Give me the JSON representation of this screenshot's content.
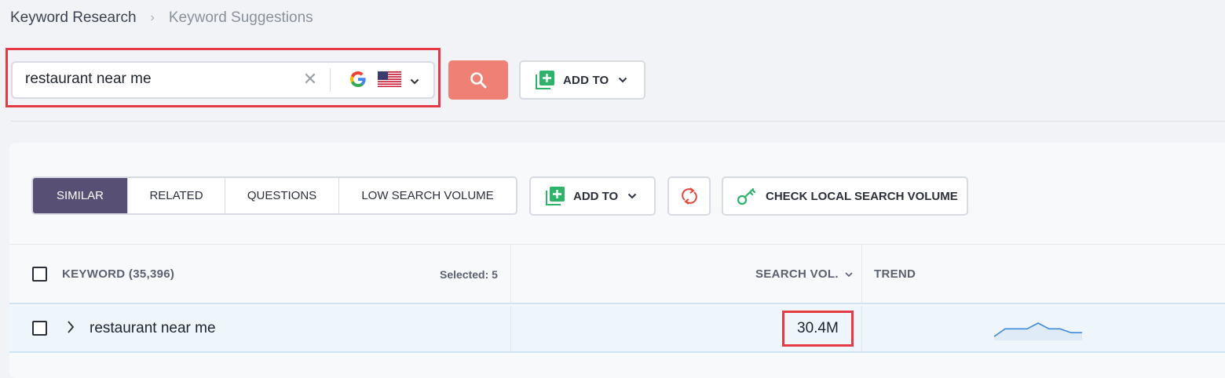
{
  "breadcrumb": {
    "root": "Keyword Research",
    "separator": "›",
    "current": "Keyword Suggestions"
  },
  "search": {
    "query": "restaurant near me",
    "clear_icon": "close-icon",
    "engine_icon": "google-icon",
    "country_icon": "us-flag-icon"
  },
  "top_toolbar": {
    "add_to_label": "ADD TO"
  },
  "tabs": [
    {
      "label": "SIMILAR",
      "active": true
    },
    {
      "label": "RELATED",
      "active": false
    },
    {
      "label": "QUESTIONS",
      "active": false
    },
    {
      "label": "LOW SEARCH VOLUME",
      "active": false
    }
  ],
  "table_toolbar": {
    "add_to_label": "ADD TO",
    "check_local_label": "CHECK LOCAL SEARCH VOLUME"
  },
  "table": {
    "keyword_header": "KEYWORD (35,396)",
    "selected_label": "Selected: 5",
    "search_vol_header": "SEARCH VOL.",
    "trend_header": "TREND",
    "rows": [
      {
        "keyword": "restaurant near me",
        "search_volume": "30.4M",
        "trend": [
          2,
          6,
          6,
          6,
          9,
          6,
          6,
          4,
          4
        ]
      }
    ]
  },
  "colors": {
    "accent_red": "#e63946",
    "search_button": "#ef8076",
    "tab_active": "#574f74",
    "green": "#2fb36b",
    "trend_line": "#3f8ad8"
  }
}
